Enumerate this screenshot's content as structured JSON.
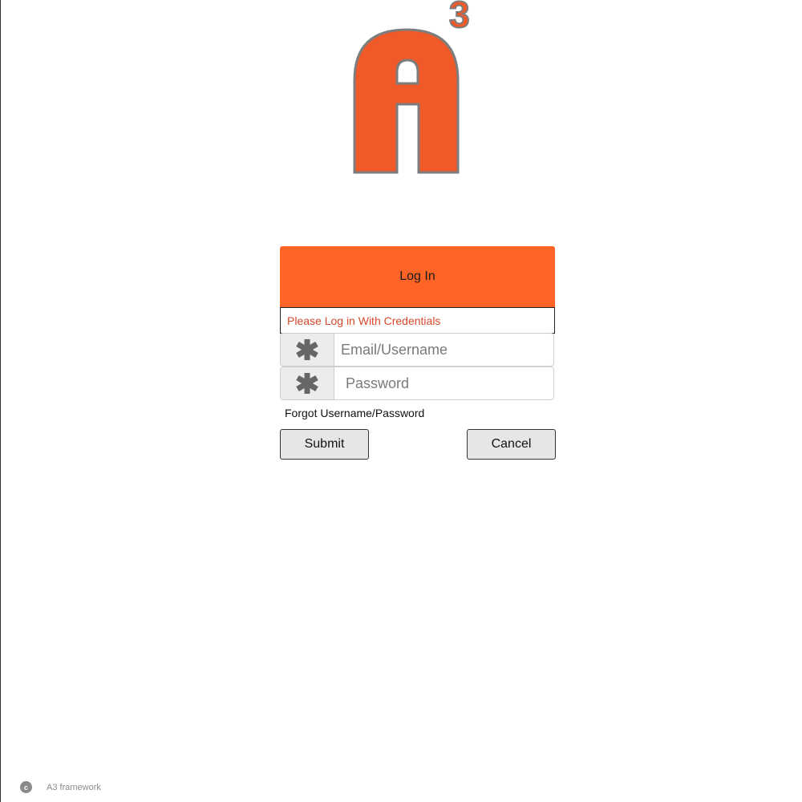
{
  "brand": {
    "logo_letter": "A",
    "logo_superscript": "3",
    "accent_color": "#ff6426",
    "logo_color": "#f05a28"
  },
  "login": {
    "title": "Log In",
    "message": "Please Log in With Credentials",
    "email_placeholder": "Email/Username",
    "password_placeholder": "Password",
    "required_icon": "asterisk-icon",
    "forgot_link": "Forgot Username/Password",
    "submit_label": "Submit",
    "cancel_label": "Cancel"
  },
  "footer": {
    "copyright_icon": "c",
    "text": "A3 framework"
  }
}
